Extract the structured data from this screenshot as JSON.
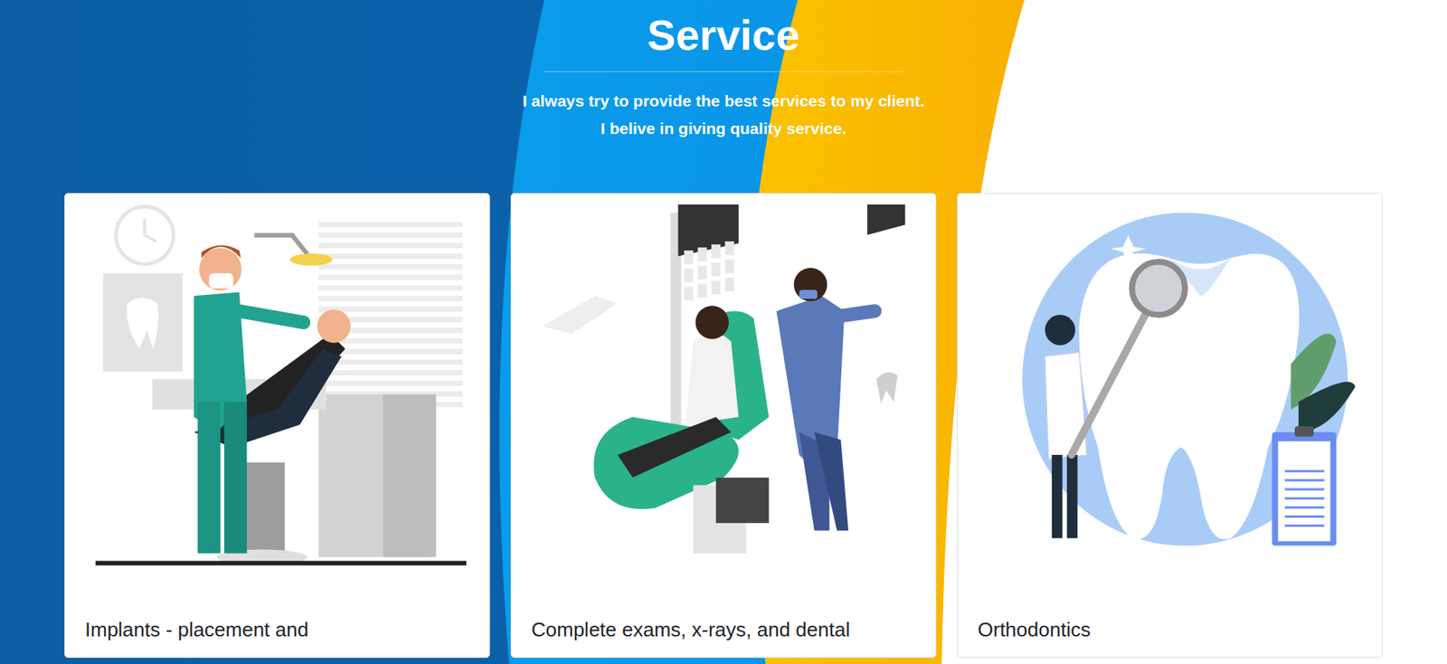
{
  "section": {
    "title": "Service",
    "subtitle": [
      "I always try to provide the best services to my client.",
      "I belive in giving quality service."
    ]
  },
  "cards": [
    {
      "title": "Implants - placement and",
      "kind": "treatment"
    },
    {
      "title": "Complete exams, x-rays, and dental",
      "kind": "xray"
    },
    {
      "title": "Orthodontics",
      "kind": "orthodontics"
    }
  ]
}
